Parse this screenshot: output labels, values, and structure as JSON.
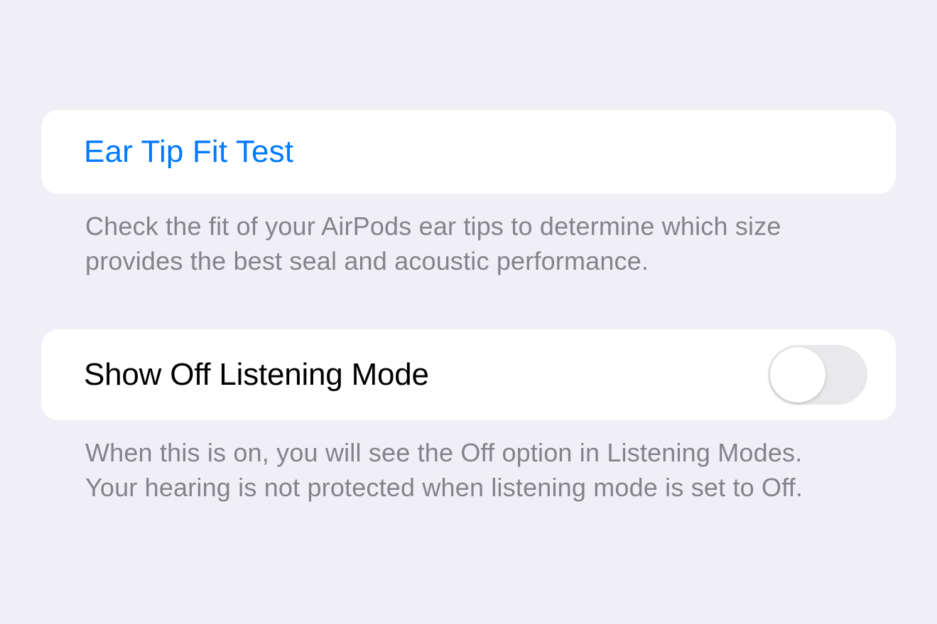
{
  "earTipSection": {
    "title": "Ear Tip Fit Test",
    "footer": "Check the fit of your AirPods ear tips to determine which size provides the best seal and acoustic performance."
  },
  "listeningModeSection": {
    "title": "Show Off Listening Mode",
    "footer": "When this is on, you will see the Off option in Listening Modes. Your hearing is not protected when listening mode is set to Off.",
    "toggleState": "off"
  }
}
